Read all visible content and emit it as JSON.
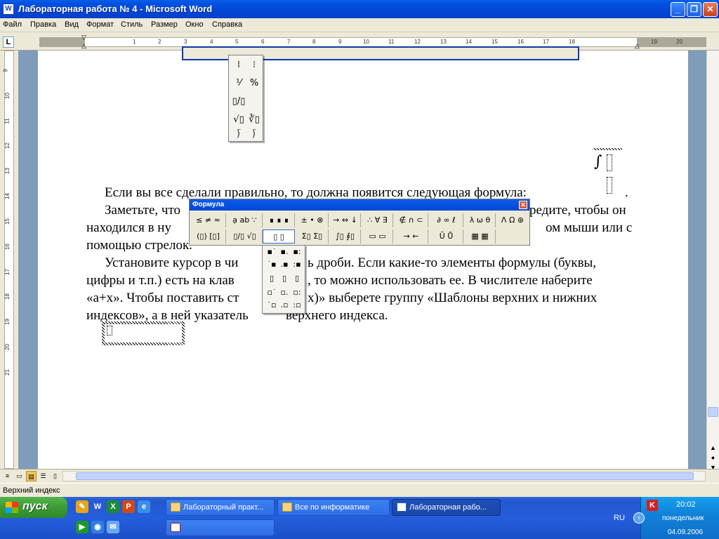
{
  "window": {
    "title": "Лабораторная работа № 4 - Microsoft Word",
    "app_icon": "W"
  },
  "menu": [
    "Файл",
    "Правка",
    "Вид",
    "Формат",
    "Стиль",
    "Размер",
    "Окно",
    "Справка"
  ],
  "ruler": {
    "ticks": [
      "1",
      "2",
      "3",
      "4",
      "5",
      "6",
      "7",
      "8",
      "9",
      "10",
      "11",
      "12",
      "13",
      "14",
      "15",
      "16",
      "17",
      "18",
      "19",
      "20"
    ],
    "corner": "L"
  },
  "vruler": {
    "ticks": [
      "9",
      "10",
      "11",
      "12",
      "13",
      "14",
      "15",
      "16",
      "17",
      "18",
      "19",
      "20",
      "21"
    ]
  },
  "document": {
    "line1": "Если вы все сделали правильно, то должна появится следующая формула:",
    "line1_end": ".",
    "line2a": "Заметьте, что",
    "line2b": "редите, чтобы он",
    "line3a": "находился в ну",
    "line3b": "ом мыши или с",
    "line4": "помощью стрелок.",
    "line5a": "Установите курсор в чи",
    "line5b": "ь дроби. Если какие-то элементы формулы (буквы,",
    "line6a": "цифры и т.п.) есть на клав",
    "line6b": ", то можно использовать ее. В числителе наберите",
    "line7a": "«a+x». Чтобы поставить ст",
    "line7b": "x)» выберете группу «Шаблоны верхних и нижних",
    "line8a": "индексов», а в ней указатель",
    "line8b": "верхнего индекса."
  },
  "formula_toolbar": {
    "title": "Формула",
    "row1": [
      "≤ ≠ ≈",
      "ạ ab ∵",
      "∎ ∎ ∎",
      "± • ⊗",
      "→ ⇔ ↓",
      "∴ ∀ ∃",
      "∉ ∩ ⊂",
      "∂ ∞ ℓ",
      "λ ω θ",
      "Λ Ω ⊛"
    ],
    "row2": [
      "(▯) [▯]",
      "▯/▯ √▯",
      "▯ ▯",
      "Σ▯ Σ▯",
      "∫▯ ∮▯",
      "▭ ▭",
      "→ ←",
      "Ū Ů",
      "▦ ▦"
    ]
  },
  "statusbar": {
    "text": "Верхний индекс"
  },
  "taskbar": {
    "start": "пуск",
    "tasks": [
      "Лабораторный практ...",
      "Все по информатике",
      "Лабораторная рабо..."
    ],
    "lang": "RU",
    "time": "20:02",
    "day": "понедельник",
    "date": "04.09.2006"
  },
  "colors": {
    "accent": "#0346d8",
    "taskbar": "#245edb",
    "start": "#3c9a36"
  }
}
